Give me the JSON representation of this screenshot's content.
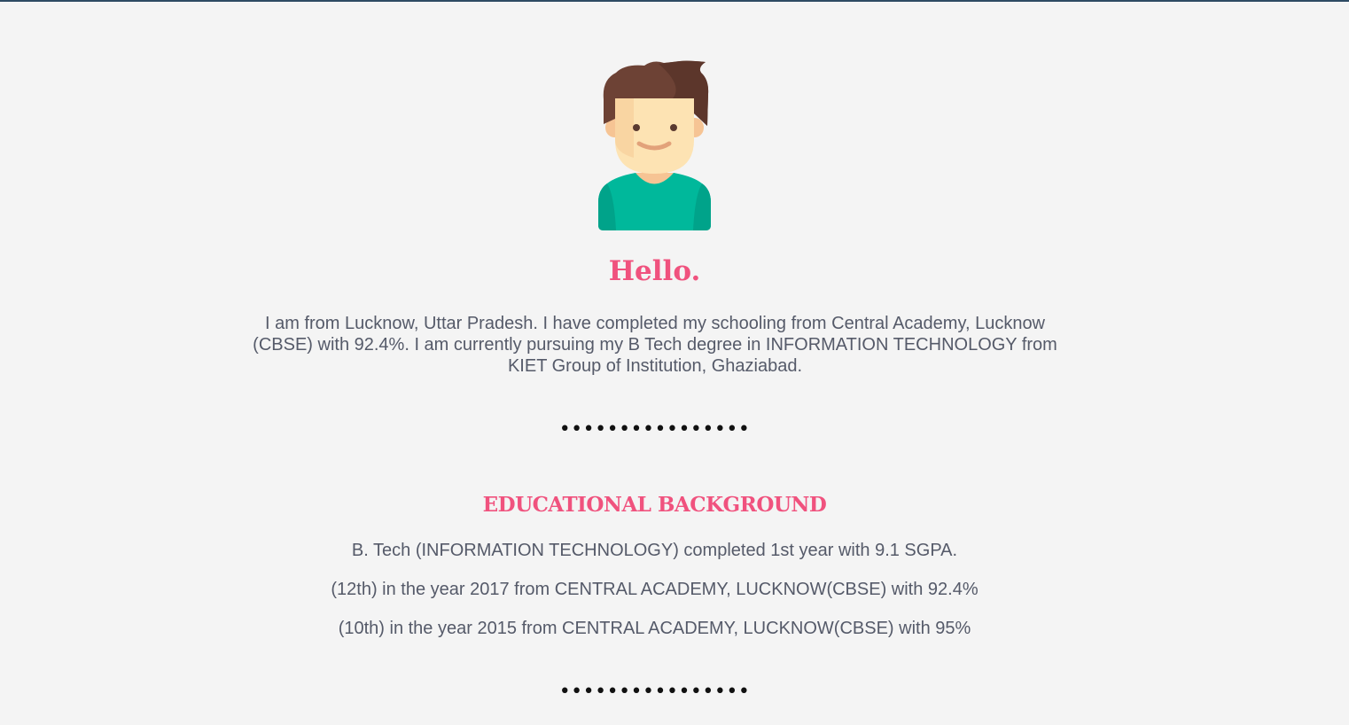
{
  "profile": {
    "avatar_icon": "boy-avatar-icon",
    "greeting": "Hello.",
    "intro": "I am from Lucknow, Uttar Pradesh. I have completed my schooling from Central Academy, Lucknow (CBSE) with 92.4%. I am currently pursuing my B Tech degree in INFORMATION TECHNOLOGY from KIET Group of Institution, Ghaziabad."
  },
  "divider": "••••••••••••••••",
  "education": {
    "title": "EDUCATIONAL BACKGROUND",
    "items": [
      "B. Tech (INFORMATION TECHNOLOGY) completed 1st year with 9.1 SGPA.",
      "(12th) in the year 2017 from CENTRAL ACADEMY, LUCKNOW(CBSE) with 92.4%",
      "(10th) in the year 2015 from CENTRAL ACADEMY, LUCKNOW(CBSE) with 95%"
    ]
  },
  "colors": {
    "accent": "#f0527e",
    "text": "#555a69",
    "background": "#f4f4f4",
    "top_border": "#2d4a63"
  }
}
